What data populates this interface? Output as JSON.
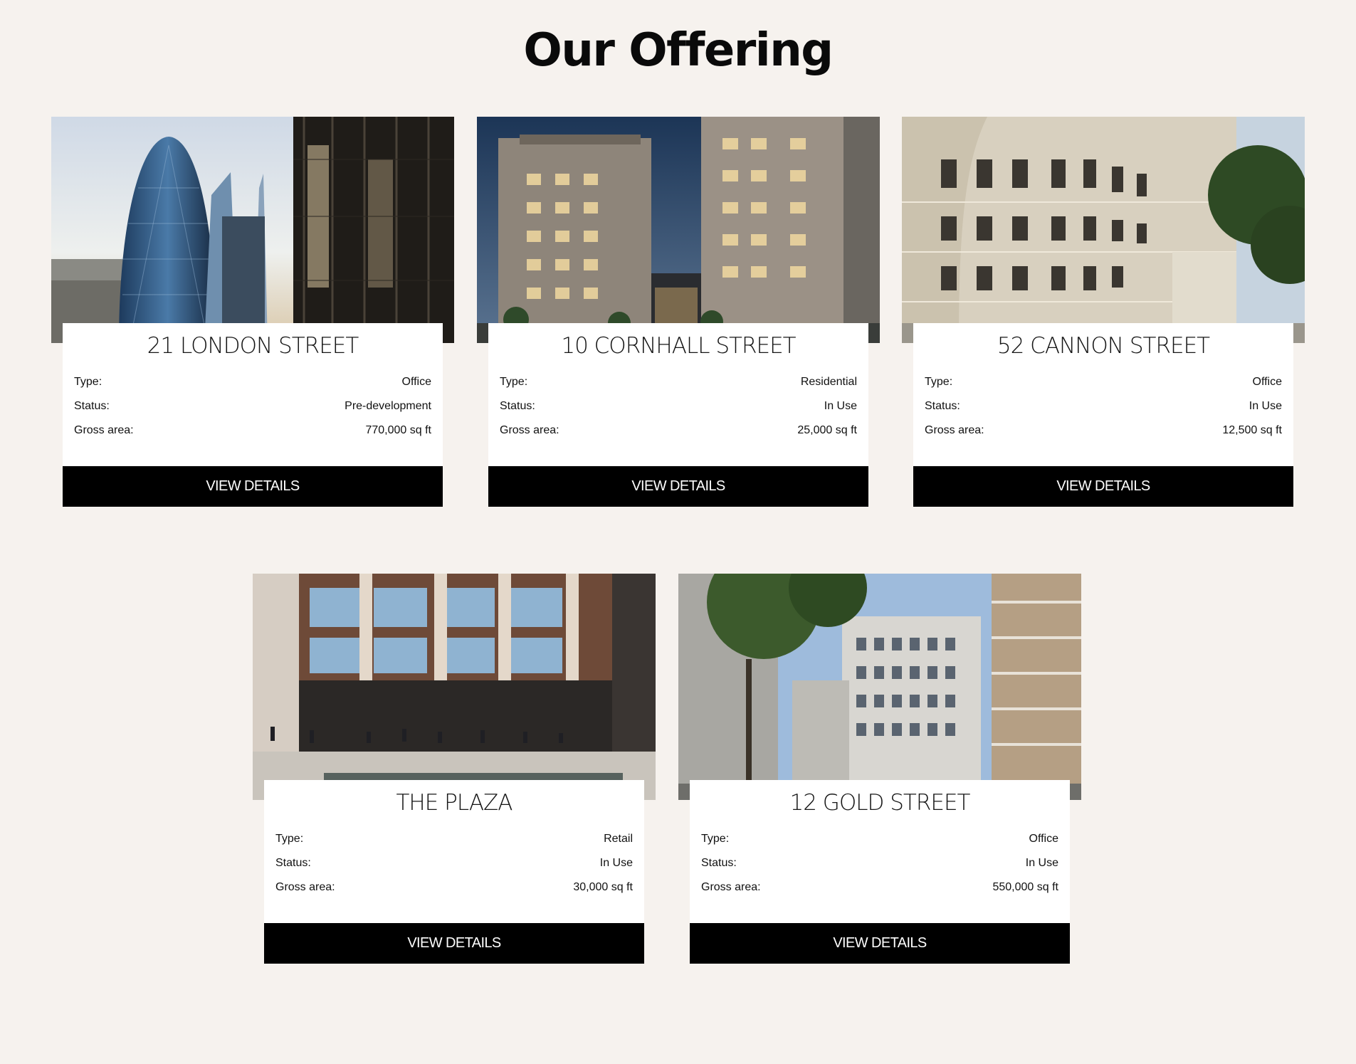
{
  "page": {
    "title": "Our Offering"
  },
  "labels": {
    "type": "Type:",
    "status": "Status:",
    "gross_area": "Gross area:"
  },
  "button_label": "VIEW DETAILS",
  "properties": [
    {
      "name": "21 LONDON STREET",
      "type": "Office",
      "status": "Pre-development",
      "gross_area": "770,000 sq ft",
      "image": "city-skyline-with-gherkin-tower"
    },
    {
      "name": "10 CORNHALL STREET",
      "type": "Residential",
      "status": "In Use",
      "gross_area": "25,000 sq ft",
      "image": "residential-apartment-blocks-at-dusk"
    },
    {
      "name": "52 CANNON STREET",
      "type": "Office",
      "status": "In Use",
      "gross_area": "12,500 sq ft",
      "image": "classical-stone-building-with-tree"
    },
    {
      "name": "THE PLAZA",
      "type": "Retail",
      "status": "In Use",
      "gross_area": "30,000 sq ft",
      "image": "modern-office-plaza-with-people"
    },
    {
      "name": "12 GOLD STREET",
      "type": "Office",
      "status": "In Use",
      "gross_area": "550,000 sq ft",
      "image": "office-blocks-with-trees"
    }
  ]
}
